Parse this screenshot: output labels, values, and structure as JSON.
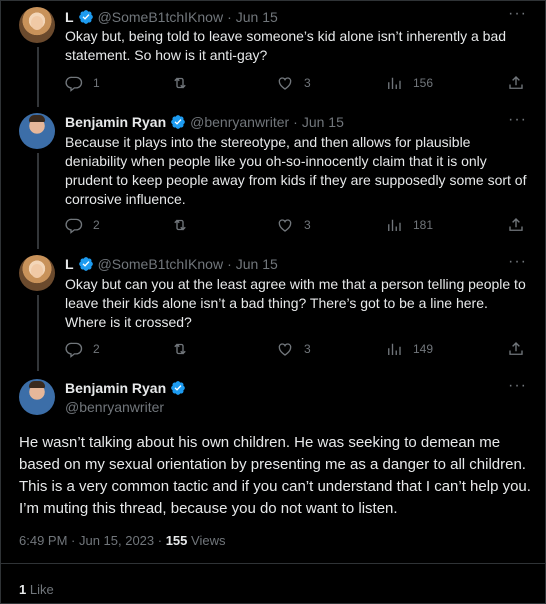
{
  "tweets": [
    {
      "name": "L",
      "handle": "@SomeB1tchIKnow",
      "date": "Jun 15",
      "text": "Okay but, being told to leave someone’s kid alone isn’t inherently a bad statement. So how is it anti-gay?",
      "replies": "1",
      "retweets": "",
      "likes": "3",
      "views": "156"
    },
    {
      "name": "Benjamin Ryan",
      "handle": "@benryanwriter",
      "date": "Jun 15",
      "text": "Because it plays into the stereotype, and then allows for plausible deniability when people like you oh-so-innocently claim that it is only prudent to keep people away from kids if they are supposedly some sort of corrosive influence.",
      "replies": "2",
      "retweets": "",
      "likes": "3",
      "views": "181"
    },
    {
      "name": "L",
      "handle": "@SomeB1tchIKnow",
      "date": "Jun 15",
      "text": "Okay but can you at the least agree with me that a person telling people to leave their kids alone isn’t a bad thing? There’s got to be a line here. Where is it crossed?",
      "replies": "2",
      "retweets": "",
      "likes": "3",
      "views": "149"
    }
  ],
  "main": {
    "name": "Benjamin Ryan",
    "handle": "@benryanwriter",
    "text": "He wasn’t talking about his own children. He was seeking to demean me based on my sexual orientation by presenting me as a danger to all children. This is a very common tactic and if you can’t understand that I can’t help you. I’m muting this thread, because you do not want to listen.",
    "timestamp": "6:49 PM · Jun 15, 2023 · ",
    "views_count": "155",
    "views_label": " Views",
    "likes_count": "1",
    "likes_label": " Like"
  },
  "ui": {
    "dot": "·",
    "more": "···"
  },
  "colors": {
    "background": "#000000",
    "text": "#e7e9ea",
    "muted": "#71767b",
    "verified": "#1d9bf0",
    "border": "#2f3336"
  }
}
